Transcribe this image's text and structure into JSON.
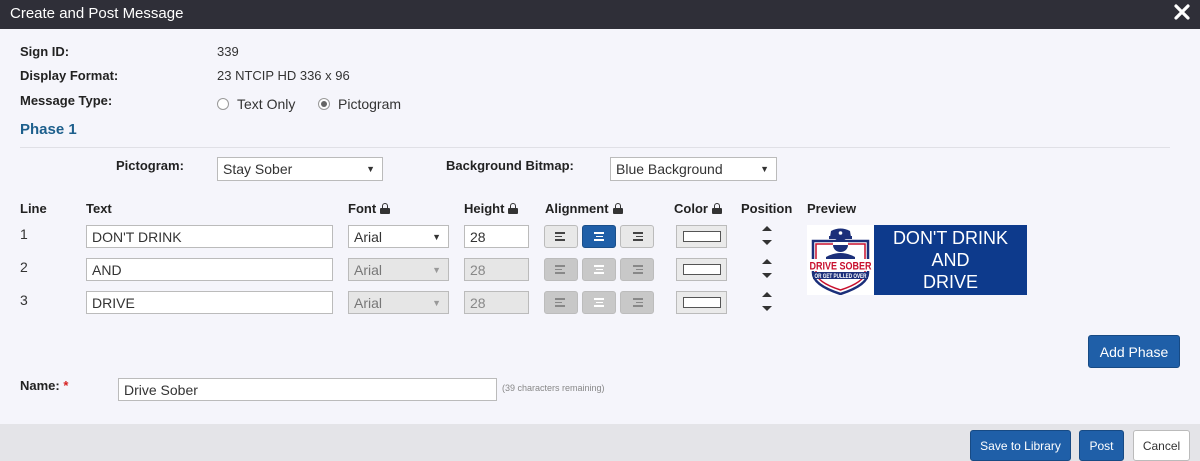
{
  "dialog": {
    "title": "Create and Post Message"
  },
  "fields": {
    "sign_id_label": "Sign ID:",
    "sign_id_value": "339",
    "display_format_label": "Display Format:",
    "display_format_value": "23 NTCIP HD 336 x 96",
    "message_type_label": "Message Type:",
    "message_type_options": [
      "Text Only",
      "Pictogram"
    ],
    "message_type_selected": "Pictogram"
  },
  "phase": {
    "title": "Phase 1",
    "pictogram_label": "Pictogram:",
    "pictogram_value": "Stay Sober",
    "background_label": "Background Bitmap:",
    "background_value": "Blue Background"
  },
  "table": {
    "headers": {
      "line": "Line",
      "text": "Text",
      "font": "Font",
      "height": "Height",
      "alignment": "Alignment",
      "color": "Color",
      "position": "Position",
      "preview": "Preview"
    },
    "rows": [
      {
        "line": "1",
        "text": "DON'T DRINK",
        "font": "Arial",
        "height": "28",
        "alignment": "center",
        "color": "#ffffff",
        "enabled": true
      },
      {
        "line": "2",
        "text": "AND",
        "font": "Arial",
        "height": "28",
        "alignment": "center",
        "color": "#ffffff",
        "enabled": false
      },
      {
        "line": "3",
        "text": "DRIVE",
        "font": "Arial",
        "height": "28",
        "alignment": "center",
        "color": "#ffffff",
        "enabled": false
      }
    ]
  },
  "preview": {
    "lines": [
      "DON'T DRINK",
      "AND",
      "DRIVE"
    ],
    "pictogram_text_top": "DRIVE SOBER",
    "pictogram_text_bottom": "OR GET PULLED OVER",
    "background_color": "#0d3a8c"
  },
  "buttons": {
    "add_phase": "Add Phase",
    "save_to_library": "Save to Library",
    "post": "Post",
    "cancel": "Cancel"
  },
  "name": {
    "label": "Name:",
    "required_mark": "*",
    "value": "Drive Sober",
    "hint": "(39 characters remaining)"
  },
  "colors": {
    "primary": "#1f5fa8",
    "titlebar": "#2f2f38",
    "phase_title": "#1d5f8c",
    "required": "#d62020"
  }
}
